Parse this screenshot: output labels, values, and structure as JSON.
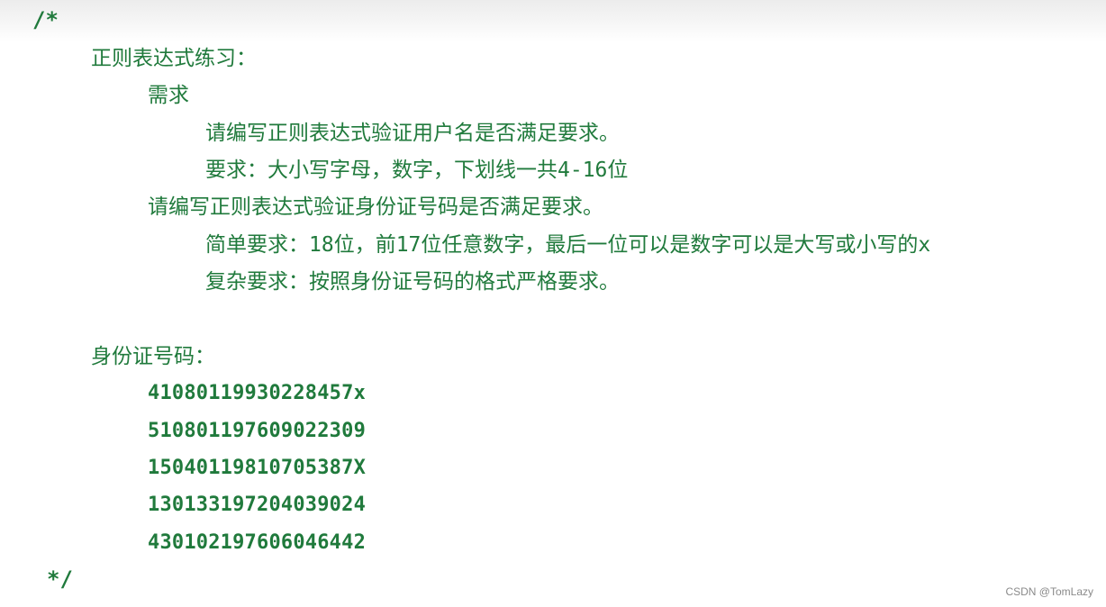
{
  "editor": {
    "comment_open": "/*",
    "comment_close": "*/",
    "lines": [
      "正则表达式练习：",
      "需求",
      "请编写正则表达式验证用户名是否满足要求。",
      "要求：大小写字母，数字，下划线一共4-16位",
      "请编写正则表达式验证身份证号码是否满足要求。",
      "简单要求：18位，前17位任意数字，最后一位可以是数字可以是大写或小写的x",
      "复杂要求：按照身份证号码的格式严格要求。",
      "身份证号码：",
      "41080119930228457x",
      "510801197609022309",
      "15040119810705387X",
      "130133197204039024",
      "430102197606046442"
    ]
  },
  "watermark": "CSDN @TomLazy"
}
